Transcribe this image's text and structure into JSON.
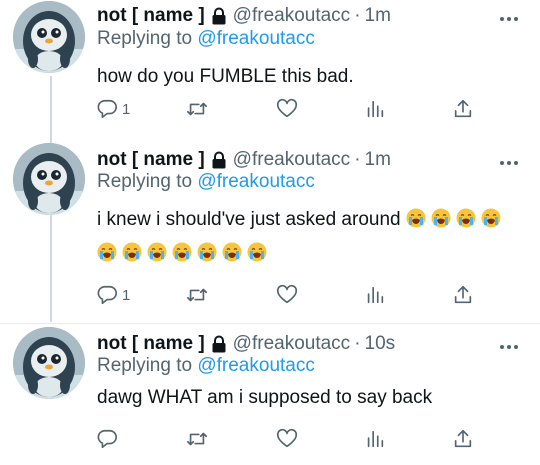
{
  "tweets": [
    {
      "display_name": "not [ name ]",
      "handle": "@freakoutacc",
      "separator": "·",
      "time": "1m",
      "replying_prefix": "Replying to",
      "replying_to": "@freakoutacc",
      "text": "how do you FUMBLE this bad.",
      "reply_count": "1"
    },
    {
      "display_name": "not [ name ]",
      "handle": "@freakoutacc",
      "separator": "·",
      "time": "1m",
      "replying_prefix": "Replying to",
      "replying_to": "@freakoutacc",
      "text": "i knew i should've just asked around",
      "emoji_count": 11,
      "emoji_icon": "loudly-crying-face-icon",
      "reply_count": "1"
    },
    {
      "display_name": "not [ name ]",
      "handle": "@freakoutacc",
      "separator": "·",
      "time": "10s",
      "replying_prefix": "Replying to",
      "replying_to": "@freakoutacc",
      "text": "dawg WHAT am i supposed to say back",
      "reply_count": ""
    }
  ],
  "icons": {
    "lock": "lock-icon",
    "more": "more-icon",
    "reply": "reply-icon",
    "retweet": "retweet-icon",
    "like": "heart-icon",
    "analytics": "analytics-icon",
    "share": "share-icon"
  },
  "colors": {
    "text": "#0f1419",
    "secondary": "#536471",
    "link": "#1d9bf0",
    "thread_line": "#cfd9de"
  }
}
